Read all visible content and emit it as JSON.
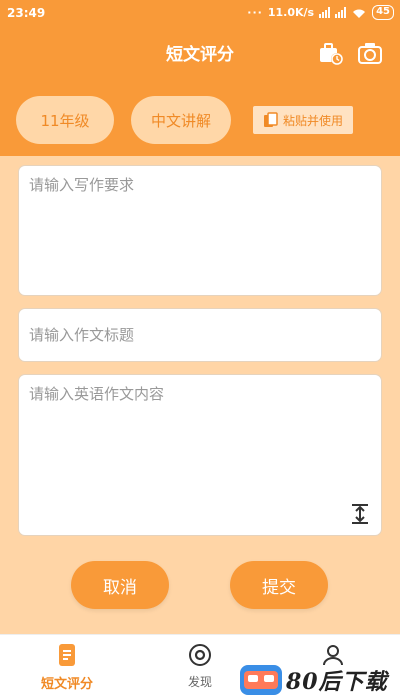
{
  "status": {
    "time": "23:49",
    "speed": "11.0K/s",
    "battery": "45"
  },
  "header": {
    "title": "短文评分"
  },
  "controls": {
    "grade_label": "11年级",
    "explain_label": "中文讲解",
    "paste_label": "粘贴并使用"
  },
  "form": {
    "requirement_placeholder": "请输入写作要求",
    "title_placeholder": "请输入作文标题",
    "content_placeholder": "请输入英语作文内容"
  },
  "actions": {
    "cancel_label": "取消",
    "submit_label": "提交"
  },
  "nav": {
    "items": [
      {
        "label": "短文评分",
        "icon": "document-icon"
      },
      {
        "label": "发现",
        "icon": "compass-icon"
      },
      {
        "label": "",
        "icon": "profile-icon"
      }
    ]
  },
  "watermark": {
    "text": "80后下载"
  },
  "colors": {
    "primary": "#f99a39",
    "pill_bg": "#ffd7a8",
    "page_bg": "#ffd5a6",
    "accent_text": "#f08a26"
  }
}
